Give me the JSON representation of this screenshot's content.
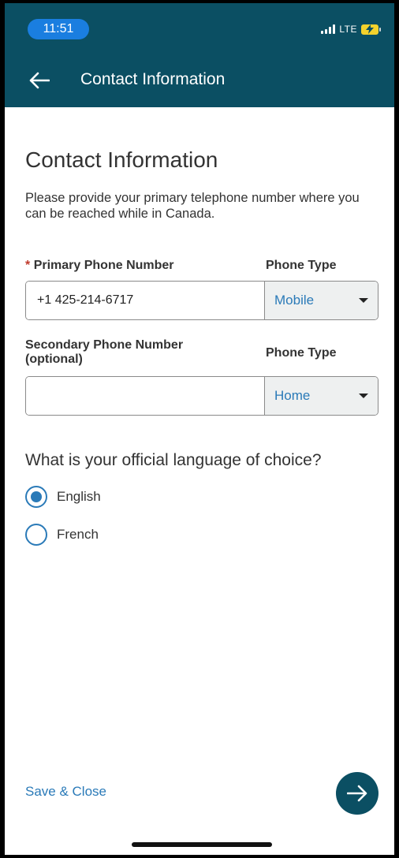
{
  "status_bar": {
    "time": "11:51",
    "network": "LTE"
  },
  "header": {
    "title": "Contact Information"
  },
  "page": {
    "title": "Contact Information",
    "intro": "Please provide your primary telephone number where you can be reached while in Canada."
  },
  "primary_phone": {
    "required_mark": "*",
    "label": "Primary Phone Number",
    "value": "+1 425-214-6717",
    "type_label": "Phone Type",
    "type_value": "Mobile"
  },
  "secondary_phone": {
    "label": "Secondary Phone Number (optional)",
    "value": "",
    "type_label": "Phone Type",
    "type_value": "Home"
  },
  "language": {
    "question": "What is your official language of choice?",
    "options": [
      {
        "label": "English",
        "selected": true
      },
      {
        "label": "French",
        "selected": false
      }
    ]
  },
  "footer": {
    "save_label": "Save & Close"
  },
  "colors": {
    "header": "#0b4f63",
    "accent": "#2a7ab8",
    "required": "#c0392b"
  }
}
